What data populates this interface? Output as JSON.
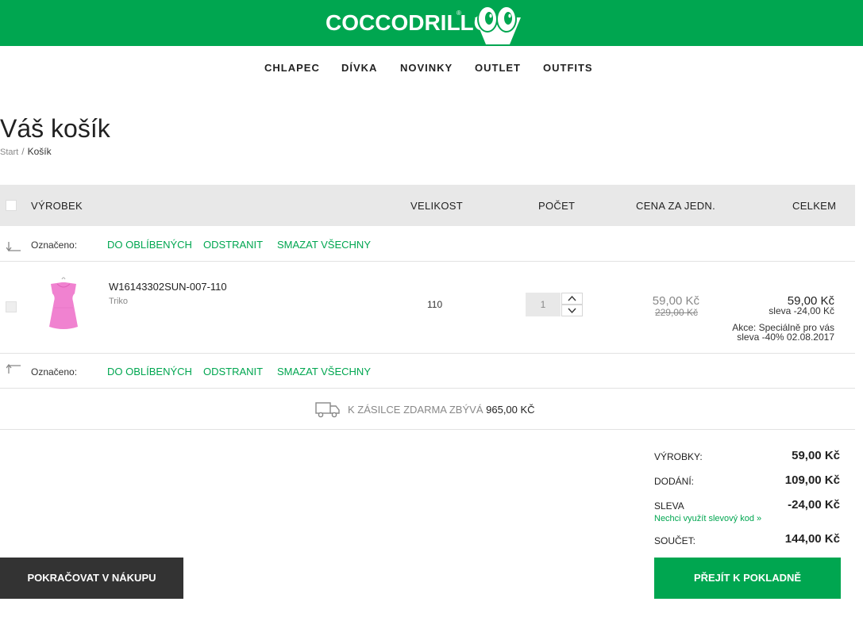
{
  "header": {
    "logo_text": "COCCODRILLO",
    "logo_reg": "®",
    "brand_color": "#00a650"
  },
  "nav": {
    "items": [
      "CHLAPEC",
      "DÍVKA",
      "NOVINKY",
      "OUTLET",
      "OUTFITS"
    ]
  },
  "page": {
    "title": "Váš košík",
    "breadcrumb": {
      "start": "Start",
      "separator": "/",
      "current": "Košík"
    }
  },
  "table": {
    "headers": {
      "product": "VÝROBEK",
      "size": "VELIKOST",
      "qty": "POČET",
      "unit_price": "CENA ZA JEDN.",
      "total": "CELKEM"
    },
    "marked_label": "Označeno:",
    "actions": {
      "favorite": "DO OBLÍBENÝCH",
      "remove": "ODSTRANIT",
      "remove_all": "SMAZAT VŠECHNY"
    },
    "item": {
      "code": "W16143302SUN-007-110",
      "type": "Triko",
      "size": "110",
      "qty": "1",
      "unit_price": "59,00 Kč",
      "unit_price_old": "229,00 Kč",
      "total": "59,00 Kč",
      "discount": "sleva -24,00 Kč",
      "promo_line1": "Akce: Speciálně pro vás",
      "promo_line2": "sleva -40% 02.08.2017"
    }
  },
  "shipping": {
    "label": "K ZÁSILCE ZDARMA ZBÝVÁ",
    "amount": "965,00 KČ",
    "icon": "truck-icon"
  },
  "summary": {
    "products_label": "VÝROBKY:",
    "products_value": "59,00 Kč",
    "delivery_label": "DODÁNÍ:",
    "delivery_value": "109,00 Kč",
    "discount_label": "SLEVA",
    "discount_value": "-24,00 Kč",
    "coupon_link": "Nechci využít slevový kod »",
    "total_label": "SOUČET:",
    "total_value": "144,00 Kč"
  },
  "buttons": {
    "continue": "POKRAČOVAT V NÁKUPU",
    "checkout": "PŘEJÍT K POKLADNĚ"
  }
}
